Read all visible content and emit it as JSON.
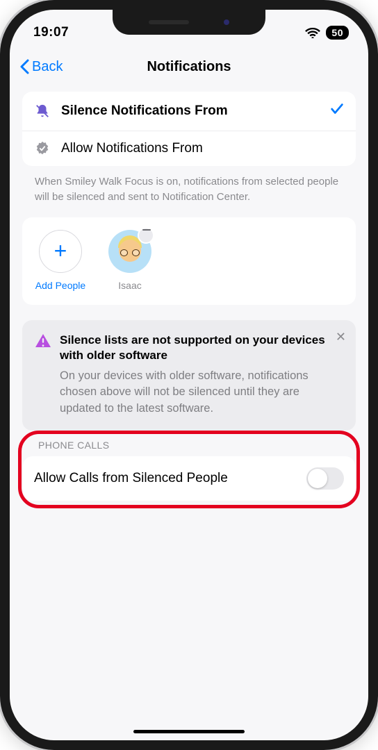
{
  "status": {
    "time": "19:07",
    "battery": "50"
  },
  "nav": {
    "back": "Back",
    "title": "Notifications"
  },
  "options": {
    "silence": {
      "label": "Silence Notifications From",
      "selected": true
    },
    "allow": {
      "label": "Allow Notifications From",
      "selected": false
    }
  },
  "helper": "When Smiley Walk Focus is on, notifications from selected people will be silenced and sent to Notification Center.",
  "people": {
    "add_label": "Add People",
    "items": [
      {
        "name": "Isaac"
      }
    ]
  },
  "info": {
    "title": "Silence lists are not supported on your devices with older software",
    "body": "On your devices with older software, notifications chosen above will not be silenced until they are updated to the latest software."
  },
  "phone_section": {
    "header": "PHONE CALLS",
    "toggle_label": "Allow Calls from Silenced People",
    "toggle_on": false
  }
}
